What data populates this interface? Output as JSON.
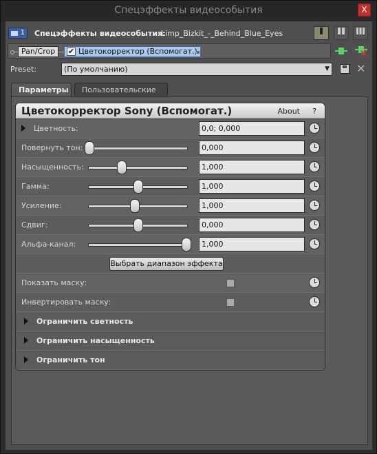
{
  "window": {
    "title": "Спецэффекты видеособытия",
    "close_label": "X"
  },
  "toolbar": {
    "track_number": "1",
    "fx_label": "Спецэффекты видеособытия:",
    "event_name": "Limp_Bizkit_-_Behind_Blue_Eyes",
    "view_buttons": [
      "single-icon",
      "split-icon",
      "grid-icon"
    ]
  },
  "chain": {
    "plugins": [
      {
        "label": "Pan/Crop"
      },
      {
        "label": "Цветокорректор (Вспомогат.)",
        "checked": true
      }
    ]
  },
  "preset": {
    "label": "Preset:",
    "value": "(По умолчанию)"
  },
  "tabs": [
    {
      "label": "Параметры",
      "active": true
    },
    {
      "label": "Пользовательские",
      "active": false
    }
  ],
  "plugin": {
    "title": "Цветокорректор Sony (Вспомогат.)",
    "about": "About",
    "help": "?",
    "params": [
      {
        "label": "Цветность:",
        "value": "0,0; 0,000",
        "slider": null,
        "expander": true
      },
      {
        "label": "Повернуть тон:",
        "value": "0,000",
        "slider": 0.0
      },
      {
        "label": "Насыщенность:",
        "value": "1,000",
        "slider": 0.33
      },
      {
        "label": "Гамма:",
        "value": "1,000",
        "slider": 0.5
      },
      {
        "label": "Усиление:",
        "value": "1,000",
        "slider": 0.47
      },
      {
        "label": "Сдвиг:",
        "value": "0,000",
        "slider": 0.5
      },
      {
        "label": "Альфа-канал:",
        "value": "1,000",
        "slider": 1.0
      }
    ],
    "range_button": "Выбрать диапазон эффекта",
    "checks": [
      {
        "label": "Показать маску:",
        "checked": false
      },
      {
        "label": "Инвертировать маску:",
        "checked": false
      }
    ],
    "groups": [
      {
        "label": "Ограничить светность"
      },
      {
        "label": "Ограничить насыщенность"
      },
      {
        "label": "Ограничить тон"
      }
    ]
  }
}
